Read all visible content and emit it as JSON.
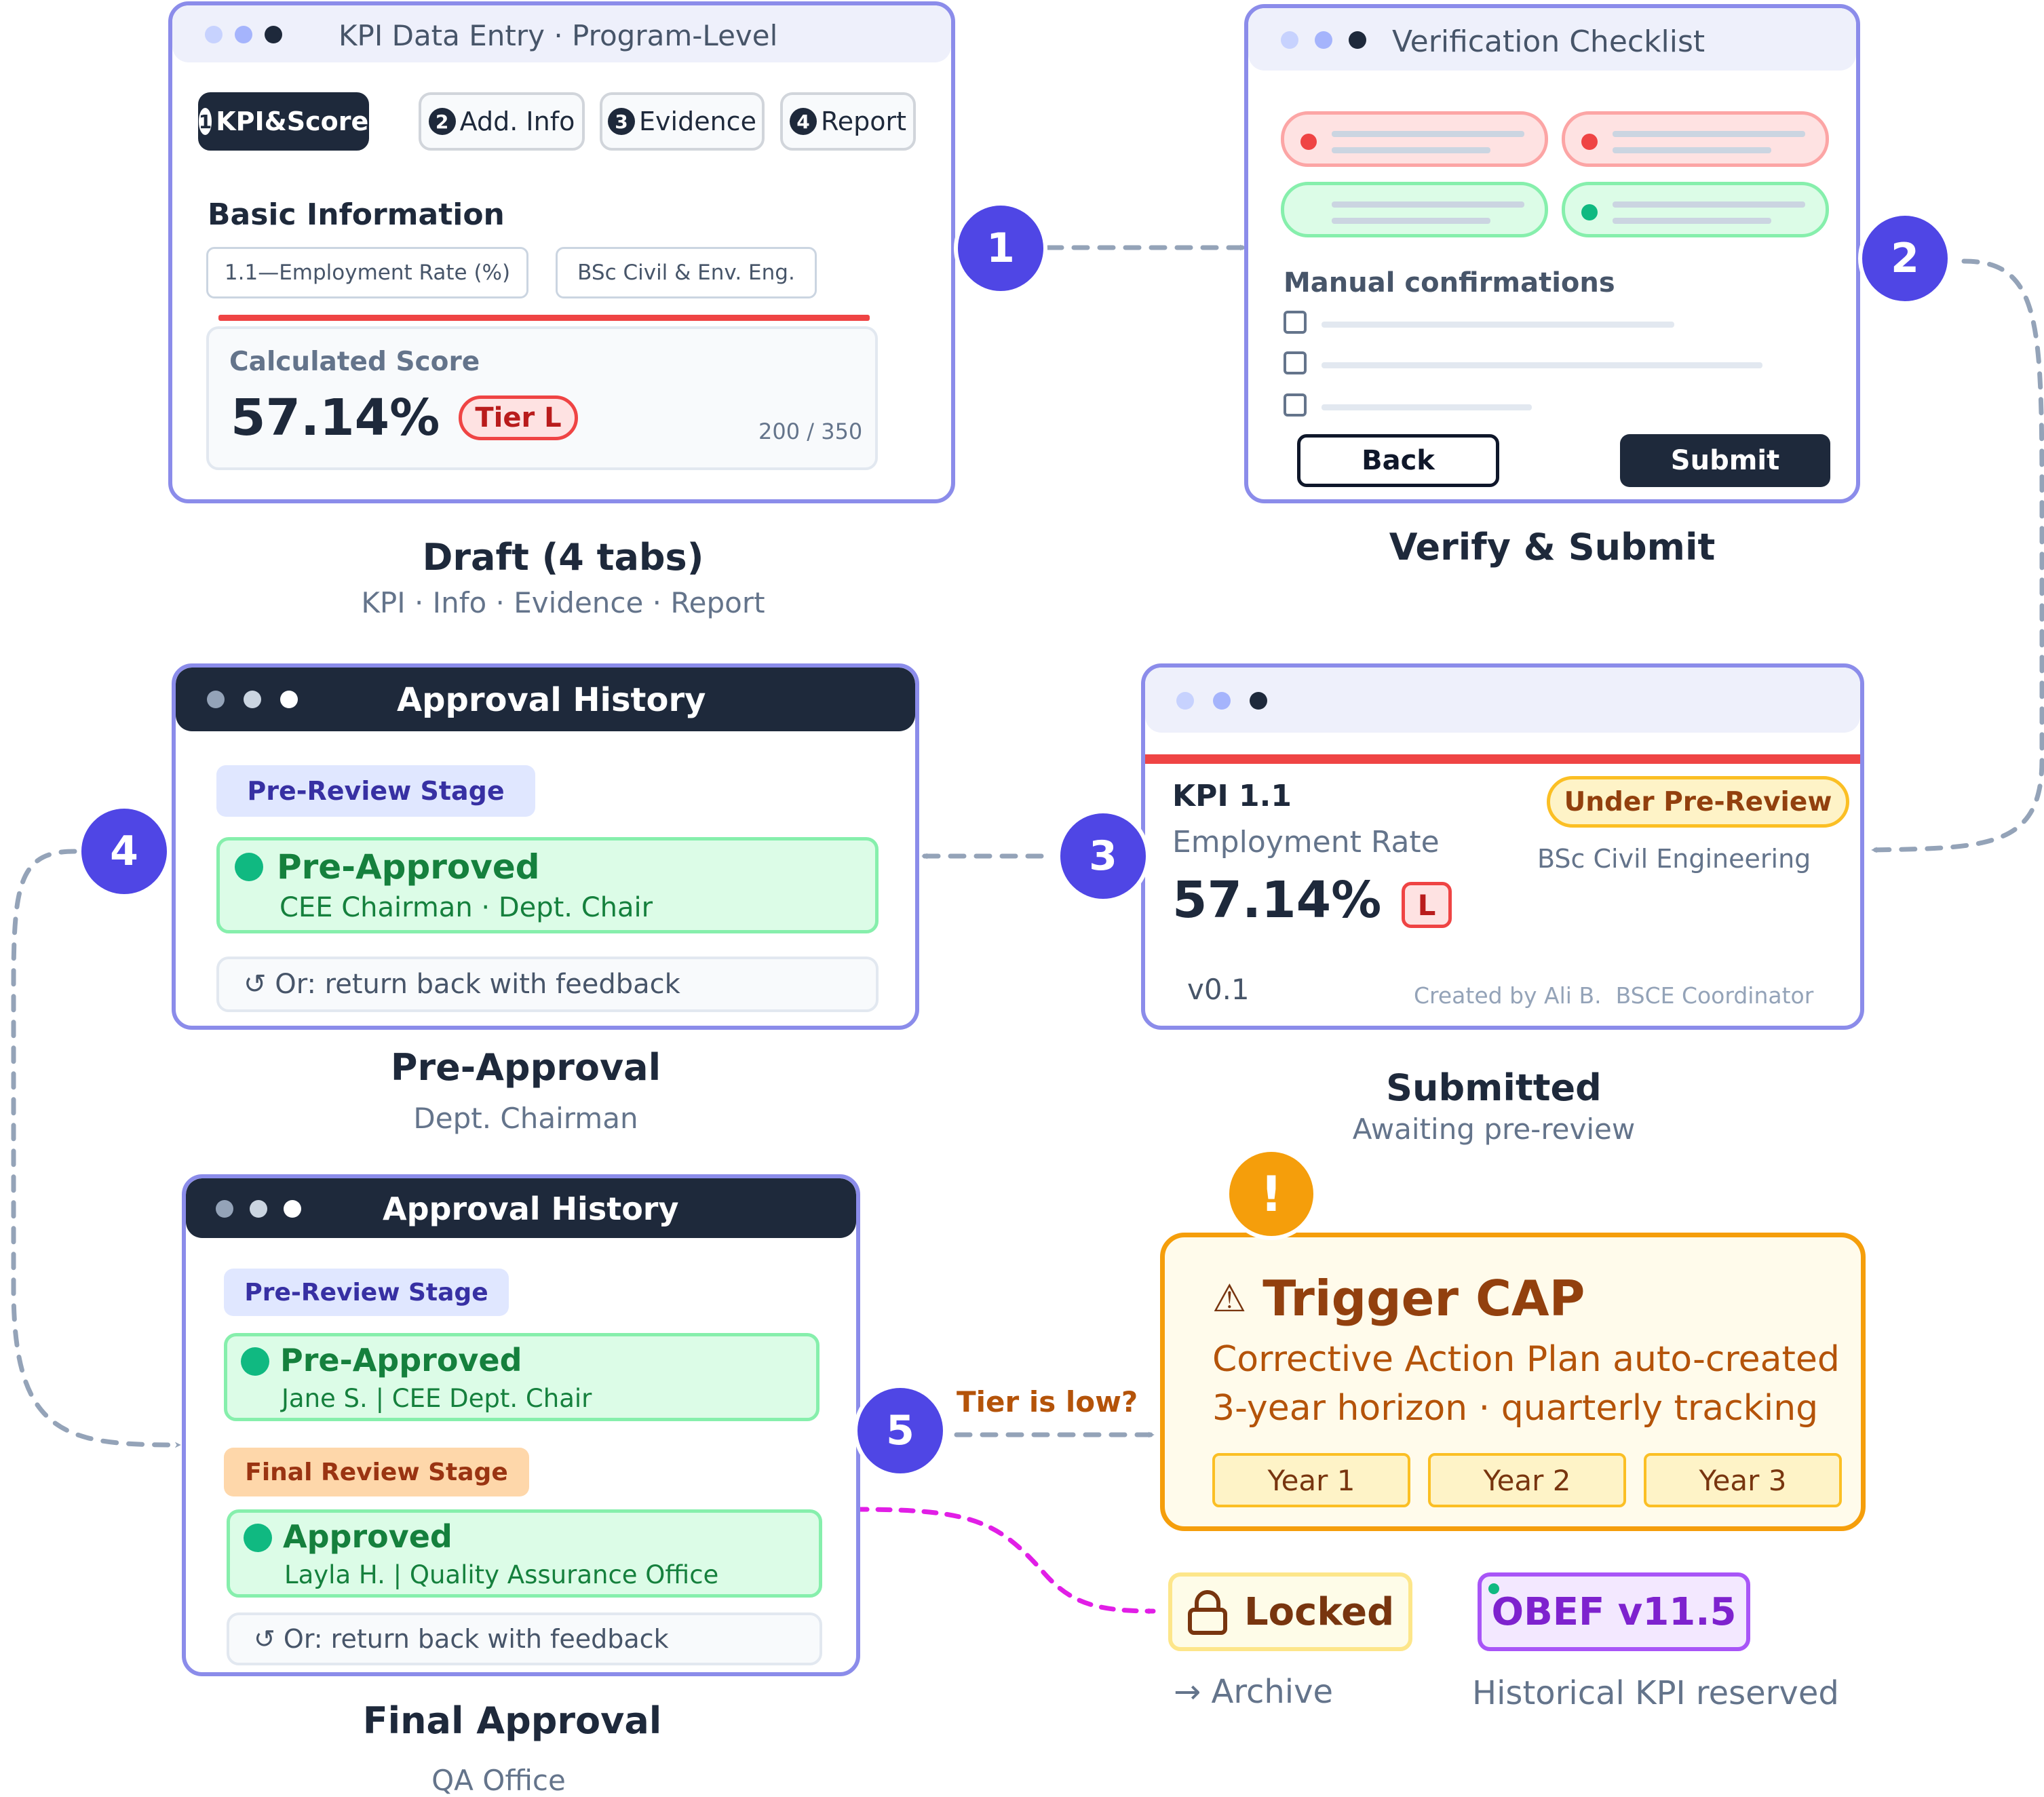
{
  "card1": {
    "title": "KPI Data Entry · Program-Level",
    "tabs": [
      {
        "num": "1",
        "label": "KPI&Score"
      },
      {
        "num": "2",
        "label": "Add. Info"
      },
      {
        "num": "3",
        "label": "Evidence"
      },
      {
        "num": "4",
        "label": "Report"
      }
    ],
    "section_title": "Basic Information",
    "kpi_field": "1.1—Employment Rate (%)",
    "program_field": "BSc Civil & Env. Eng.",
    "score_label": "Calculated Score",
    "score_value": "57.14%",
    "tier_badge": "Tier L",
    "ratio": "200 / 350",
    "caption": "Draft (4 tabs)",
    "subcaption": "KPI · Info · Evidence · Report"
  },
  "card2": {
    "title": "Verification Checklist",
    "manual_label": "Manual confirmations",
    "back_label": "Back",
    "submit_label": "Submit",
    "caption": "Verify & Submit"
  },
  "card3": {
    "kpi_id": "KPI 1.1",
    "kpi_name": "Employment Rate",
    "status_badge": "Under Pre-Review",
    "program": "BSc Civil Engineering",
    "score_value": "57.14%",
    "tier_badge": "L",
    "version": "v0.1",
    "created_by": "Created by Ali B.  BSCE Coordinator",
    "caption": "Submitted",
    "subcaption": "Awaiting pre-review"
  },
  "card4": {
    "title": "Approval History",
    "stage": "Pre-Review Stage",
    "status": "Pre-Approved",
    "approver": "CEE Chairman · Dept. Chair",
    "feedback": "↺ Or: return back with feedback",
    "caption": "Pre-Approval",
    "subcaption": "Dept. Chairman"
  },
  "card5": {
    "title": "Approval History",
    "stage1": "Pre-Review Stage",
    "status1": "Pre-Approved",
    "approver1": "Jane S. | CEE Dept. Chair",
    "stage2": "Final Review Stage",
    "status2": "Approved",
    "approver2": "Layla H. | Quality Assurance Office",
    "feedback": "↺ Or: return back with feedback",
    "caption": "Final Approval",
    "subcaption": "QA Office"
  },
  "cap": {
    "alert": "!",
    "warning_icon": "⚠",
    "title": "Trigger CAP",
    "line1": "Corrective Action Plan auto-created",
    "line2": "3-year horizon · quarterly tracking",
    "years": [
      "Year 1",
      "Year 2",
      "Year 3"
    ]
  },
  "steps": [
    "1",
    "2",
    "3",
    "4",
    "5"
  ],
  "tier_question": "Tier is low?",
  "locked": {
    "label": "Locked",
    "icon": "lock-icon",
    "archive": "→ Archive"
  },
  "obef": {
    "label": "OBEF v11.5",
    "note": "Historical KPI reserved"
  },
  "colors": {
    "accent": "#4f46e5",
    "frame": "#8b8cea",
    "dark": "#1e293b",
    "red": "#ef4444",
    "green": "#10b981",
    "amber": "#f59e0b",
    "magenta": "#e11ee6",
    "purple": "#9333ea"
  }
}
